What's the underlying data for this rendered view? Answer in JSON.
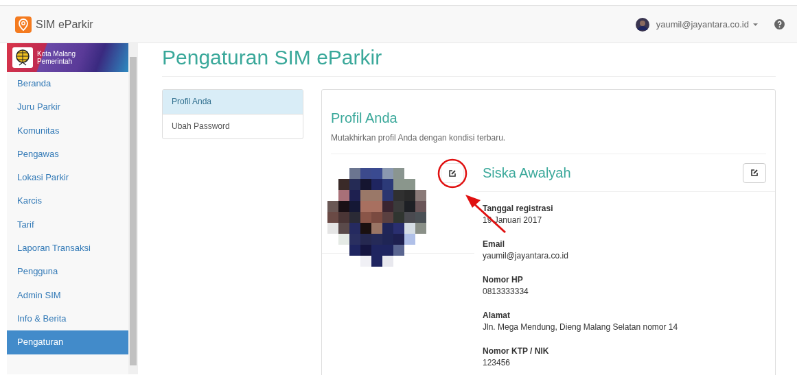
{
  "navbar": {
    "brand": "SIM eParkir",
    "user": "yaumil@jayantara.co.id"
  },
  "sidebar": {
    "banner": {
      "city": "Kota Malang",
      "subtitle": "Pemerintah"
    },
    "items": [
      {
        "label": "Beranda",
        "selected": false
      },
      {
        "label": "Juru Parkir",
        "selected": false
      },
      {
        "label": "Komunitas",
        "selected": false
      },
      {
        "label": "Pengawas",
        "selected": false
      },
      {
        "label": "Lokasi Parkir",
        "selected": false
      },
      {
        "label": "Karcis",
        "selected": false
      },
      {
        "label": "Tarif",
        "selected": false
      },
      {
        "label": "Laporan Transaksi",
        "selected": false
      },
      {
        "label": "Pengguna",
        "selected": false
      },
      {
        "label": "Admin SIM",
        "selected": false
      },
      {
        "label": "Info & Berita",
        "selected": false
      },
      {
        "label": "Pengaturan",
        "selected": true
      }
    ]
  },
  "page_title": "Pengaturan SIM eParkir",
  "settings_menu": [
    {
      "label": "Profil Anda",
      "selected": true
    },
    {
      "label": "Ubah Password",
      "selected": false
    }
  ],
  "panel": {
    "title": "Profil Anda",
    "subtitle": "Mutakhirkan profil Anda dengan kondisi terbaru.",
    "profile_name": "Siska Awalyah",
    "fields": [
      {
        "label": "Tanggal registrasi",
        "value": "19 Januari 2017"
      },
      {
        "label": "Email",
        "value": "yaumil@jayantara.co.id"
      },
      {
        "label": "Nomor HP",
        "value": "0813333334"
      },
      {
        "label": "Alamat",
        "value": "Jln. Mega Mendung, Dieng Malang Selatan nomor 14"
      },
      {
        "label": "Nomor KTP / NIK",
        "value": "123456"
      }
    ]
  }
}
